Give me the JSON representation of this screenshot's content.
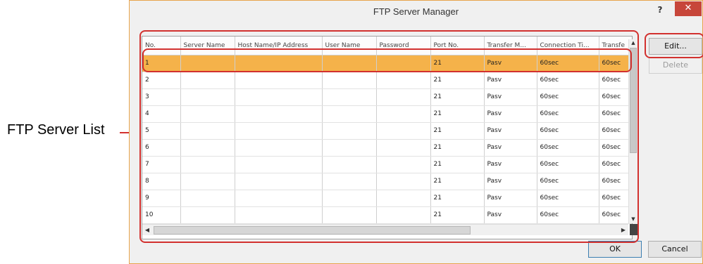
{
  "annotation": {
    "label": "FTP Server List"
  },
  "window": {
    "title": "FTP Server Manager",
    "help_label": "?",
    "close_label": "✕"
  },
  "grid": {
    "columns": [
      "No.",
      "Server Name",
      "Host Name/IP Address",
      "User Name",
      "Password",
      "Port No.",
      "Transfer M...",
      "Connection Ti...",
      "Transfe"
    ],
    "rows": [
      [
        "1",
        "",
        "",
        "",
        "",
        "21",
        "Pasv",
        "60sec",
        "60sec"
      ],
      [
        "2",
        "",
        "",
        "",
        "",
        "21",
        "Pasv",
        "60sec",
        "60sec"
      ],
      [
        "3",
        "",
        "",
        "",
        "",
        "21",
        "Pasv",
        "60sec",
        "60sec"
      ],
      [
        "4",
        "",
        "",
        "",
        "",
        "21",
        "Pasv",
        "60sec",
        "60sec"
      ],
      [
        "5",
        "",
        "",
        "",
        "",
        "21",
        "Pasv",
        "60sec",
        "60sec"
      ],
      [
        "6",
        "",
        "",
        "",
        "",
        "21",
        "Pasv",
        "60sec",
        "60sec"
      ],
      [
        "7",
        "",
        "",
        "",
        "",
        "21",
        "Pasv",
        "60sec",
        "60sec"
      ],
      [
        "8",
        "",
        "",
        "",
        "",
        "21",
        "Pasv",
        "60sec",
        "60sec"
      ],
      [
        "9",
        "",
        "",
        "",
        "",
        "21",
        "Pasv",
        "60sec",
        "60sec"
      ],
      [
        "10",
        "",
        "",
        "",
        "",
        "21",
        "Pasv",
        "60sec",
        "60sec"
      ]
    ],
    "selected_row": 0
  },
  "buttons": {
    "edit": "Edit...",
    "delete": "Delete",
    "ok": "OK",
    "cancel": "Cancel"
  },
  "colors": {
    "highlight": "#d2312f",
    "selection": "#f5b24a"
  }
}
